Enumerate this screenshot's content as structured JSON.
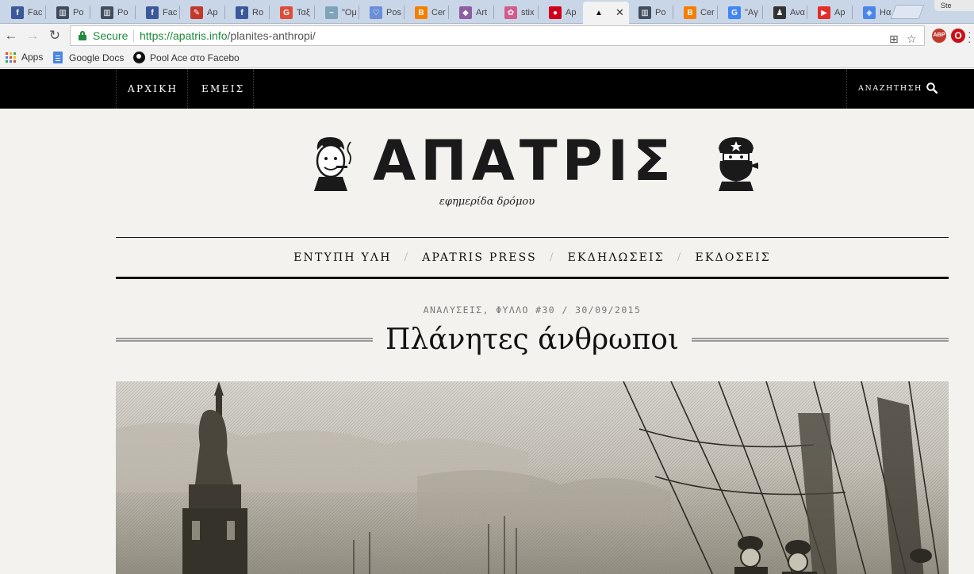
{
  "browser": {
    "tabs": [
      {
        "label": "Fac",
        "favicon": "facebook-icon",
        "color": "#3b5998",
        "glyph": "f"
      },
      {
        "label": "Po",
        "favicon": "chart-icon",
        "color": "#3f4d5e",
        "glyph": "▥"
      },
      {
        "label": "Po",
        "favicon": "chart-icon",
        "color": "#3f4d5e",
        "glyph": "▥"
      },
      {
        "label": "Fac",
        "favicon": "facebook-icon",
        "color": "#3b5998",
        "glyph": "f"
      },
      {
        "label": "Ap",
        "favicon": "pen-icon",
        "color": "#c0392b",
        "glyph": "✎"
      },
      {
        "label": "Ro",
        "favicon": "facebook-icon",
        "color": "#3b5998",
        "glyph": "f"
      },
      {
        "label": "Ταξ",
        "favicon": "google-plus-icon",
        "color": "#dd4b39",
        "glyph": "G"
      },
      {
        "label": "\"Oμ",
        "favicon": "boat-icon",
        "color": "#7da4b8",
        "glyph": "~"
      },
      {
        "label": "Pos",
        "favicon": "heart-icon",
        "color": "#6a8fd8",
        "glyph": "♡"
      },
      {
        "label": "Cer",
        "favicon": "blogger-icon",
        "color": "#f57d00",
        "glyph": "B"
      },
      {
        "label": "Art",
        "favicon": "art-icon",
        "color": "#8e5ea2",
        "glyph": "◆"
      },
      {
        "label": "stix",
        "favicon": "flower-icon",
        "color": "#d35a8c",
        "glyph": "✿"
      },
      {
        "label": "Ap",
        "favicon": "red-circle-icon",
        "color": "#d0021b",
        "glyph": "●"
      },
      {
        "label": "",
        "favicon": "apatris-icon",
        "color": "#f2f2f2",
        "glyph": "▲",
        "active": true
      },
      {
        "label": "Po",
        "favicon": "chart-icon",
        "color": "#3f4d5e",
        "glyph": "▥"
      },
      {
        "label": "Cer",
        "favicon": "blogger-icon",
        "color": "#f57d00",
        "glyph": "B"
      },
      {
        "label": "\"Aγ",
        "favicon": "google-icon",
        "color": "#4285f4",
        "glyph": "G"
      },
      {
        "label": "Ανα",
        "favicon": "figure-icon",
        "color": "#333333",
        "glyph": "♟"
      },
      {
        "label": "Ap",
        "favicon": "youtube-icon",
        "color": "#e52d27",
        "glyph": "▶"
      },
      {
        "label": "Hα",
        "favicon": "shield-icon",
        "color": "#4a86e8",
        "glyph": "◈"
      }
    ],
    "profile_label": "Ste",
    "secure_label": "Secure",
    "url_host": "https://apatris.info",
    "url_path": "/planites-anthropi/",
    "bookmarks": [
      {
        "label": "Apps",
        "icon": "apps-icon"
      },
      {
        "label": "Google Docs",
        "icon": "docs-icon"
      },
      {
        "label": "Pool Ace στο Facebo",
        "icon": "pool-ball-icon"
      }
    ],
    "ext_abp": "ABP"
  },
  "site": {
    "topnav": [
      "ΑΡΧΙΚΗ",
      "ΕΜΕΙΣ"
    ],
    "search_label": "ΑΝΑΖΗΤΗΣΗ",
    "logo_text": "ΑΠΑΤΡΙΣ",
    "tagline": "εφημερίδα δρόμου",
    "mainnav": [
      "ΕΝΤΥΠΗ ΥΛΗ",
      "APATRIS PRESS",
      "ΕΚΔΗΛΩΣΕΙΣ",
      "ΕΚΔΟΣΕΙΣ"
    ],
    "post_meta": "ΑΝΑΛΥΣΕΙΣ, ΦΥΛΛΟ #30 / 30/09/2015",
    "post_title": "Πλάνητες άνθρωποι"
  }
}
